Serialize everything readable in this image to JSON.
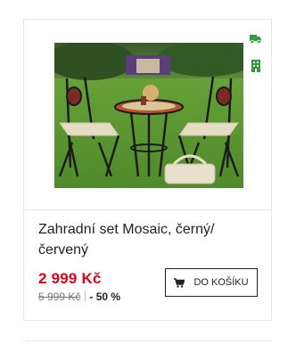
{
  "product": {
    "title": "Zahradní set Mosaic, černý/ červený",
    "price": "2 999 Kč",
    "old_price": "5 999 Kč",
    "discount": "- 50 %",
    "image_icon": "garden-furniture-photo"
  },
  "badges": {
    "delivery_icon": "delivery-truck-icon",
    "stock_icon": "in-stock-building-icon",
    "color": "#2e9e3a"
  },
  "actions": {
    "add_to_cart_label": "DO KOŠÍKU",
    "cart_icon": "cart-icon"
  },
  "colors": {
    "price": "#e2001a",
    "border": "#e6e6e6"
  }
}
